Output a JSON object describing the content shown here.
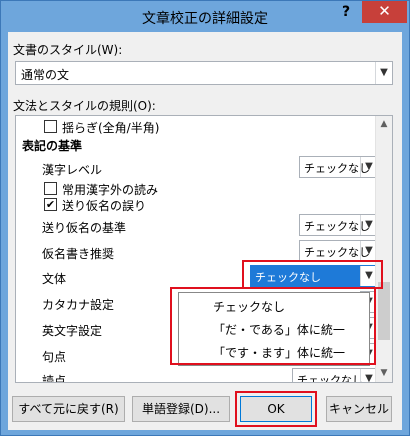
{
  "window": {
    "title": "文章校正の詳細設定",
    "help_label": "?",
    "close_label": "✕"
  },
  "style_section": {
    "label": "文書のスタイル(W):",
    "selected": "通常の文"
  },
  "rules_section": {
    "label": "文法とスタイルの規則(O):",
    "items": [
      {
        "label": "揺らぎ(全角/半角)",
        "checked": false
      },
      {
        "label": "表記の基準",
        "is_header": true
      },
      {
        "label": "漢字レベル",
        "value": "チェックなし"
      },
      {
        "label": "常用漢字外の読み",
        "checked": false
      },
      {
        "label": "送り仮名の誤り",
        "checked": true
      },
      {
        "label": "送り仮名の基準",
        "value": "チェックなし"
      },
      {
        "label": "仮名書き推奨",
        "value": "チェックなし"
      },
      {
        "label": "文体",
        "value": "チェックなし"
      },
      {
        "label": "カタカナ設定",
        "value": ""
      },
      {
        "label": "英文字設定",
        "value": ""
      },
      {
        "label": "句点",
        "value": ""
      },
      {
        "label": "読点",
        "value": "チェックなし"
      }
    ],
    "dropdown_options": [
      "チェックなし",
      "「だ・である」体に統一",
      "「です・ます」体に統一"
    ]
  },
  "buttons": {
    "reset": "すべて元に戻す(R)",
    "dictionary": "単語登録(D)...",
    "ok": "OK",
    "cancel": "キャンセル"
  },
  "colors": {
    "titlebar": "#6ea6dc",
    "close": "#c7403a",
    "highlight": "#e0101e",
    "selection": "#1e7ad8"
  }
}
